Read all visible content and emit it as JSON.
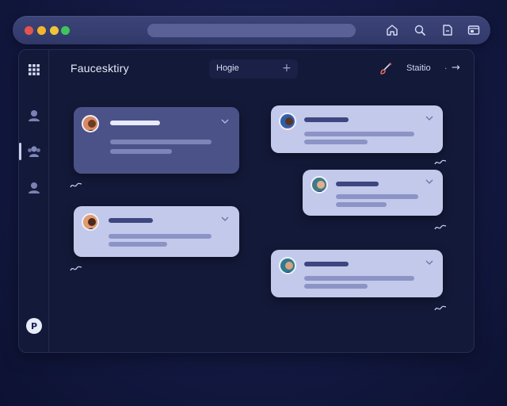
{
  "window": {
    "traffic_lights": [
      "#e4544f",
      "#f3b52b",
      "#f0c43a",
      "#3fc55a"
    ]
  },
  "toolbar": {
    "icons": [
      "home-icon",
      "search-icon",
      "bookmark-icon",
      "window-icon"
    ]
  },
  "app": {
    "title": "Faucesktiry"
  },
  "header": {
    "tab_label": "Hogie",
    "add_symbol": "+",
    "status_label": "Staitio",
    "status_separator": "·",
    "status_arrow": "→"
  },
  "sidebar": {
    "items": [
      "user-icon",
      "group-icon",
      "user-icon"
    ],
    "active_index": 1,
    "badge_label": "P"
  },
  "messages": {
    "left": [
      {
        "style": "dark",
        "avatar": "avatar-1"
      },
      {
        "style": "light",
        "avatar": "avatar-2"
      }
    ],
    "right": [
      {
        "style": "light",
        "avatar": "avatar-3"
      },
      {
        "style": "light",
        "avatar": "avatar-4"
      },
      {
        "style": "light",
        "avatar": "avatar-5"
      }
    ]
  },
  "colors": {
    "accent": "#c3c9eb",
    "card_dark": "#4a5288",
    "panel": "#131938"
  }
}
